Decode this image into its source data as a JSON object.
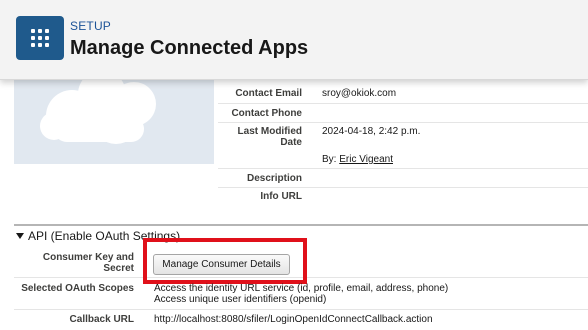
{
  "header": {
    "section_label": "SETUP",
    "title": "Manage Connected Apps",
    "icon": "app-grid-icon",
    "icon_bg": "#1f5a8c"
  },
  "details": {
    "contact_email": {
      "label": "Contact Email",
      "value": "sroy@okiok.com"
    },
    "contact_phone": {
      "label": "Contact Phone",
      "value": ""
    },
    "last_modified": {
      "label_line1": "Last Modified",
      "label_line2": "Date",
      "value": "2024-04-18, 2:42 p.m.",
      "by_prefix": "By:",
      "by_name": "Eric Vigeant"
    },
    "description": {
      "label": "Description",
      "value": ""
    },
    "info_url": {
      "label": "Info URL",
      "value": ""
    }
  },
  "api_section": {
    "title": "API (Enable OAuth Settings)",
    "consumer_key": {
      "label_line1": "Consumer Key and",
      "label_line2": "Secret",
      "button_label": "Manage Consumer Details"
    },
    "scopes": {
      "label": "Selected OAuth Scopes",
      "values": [
        "Access the identity URL service (id, profile, email, address, phone)",
        "Access unique user identifiers (openid)"
      ]
    },
    "callback": {
      "label": "Callback URL",
      "value": "http://localhost:8080/sfiler/LoginOpenIdConnectCallback.action"
    },
    "highlight_color": "#e0101a"
  }
}
